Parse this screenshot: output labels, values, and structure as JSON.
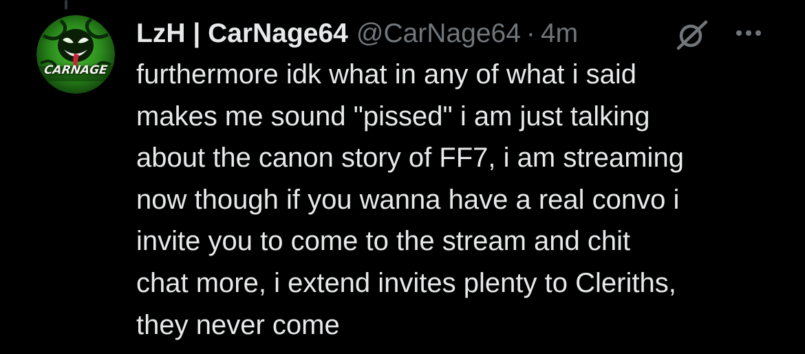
{
  "author": {
    "display_name": "LzH | CarNage64",
    "handle": "@CarNage64",
    "separator": "·",
    "timestamp": "4m",
    "avatar_text": "CARNAGE"
  },
  "tweet": {
    "lines": [
      "furthermore idk what in any of what i said",
      "makes me sound \"pissed\" i am just talking",
      "about the canon story of FF7, i am streaming",
      "now though if you wanna have a real convo i",
      "invite you to come to the stream and chit",
      "chat more, i extend invites plenty to Cleriths,",
      "they never come"
    ]
  },
  "icons": {
    "grok": "grok-icon",
    "more": "more-options-icon"
  },
  "colors": {
    "background": "#000000",
    "primary_text": "#e7e9ea",
    "secondary_text": "#71767b",
    "avatar_green": "#3fae2a"
  }
}
